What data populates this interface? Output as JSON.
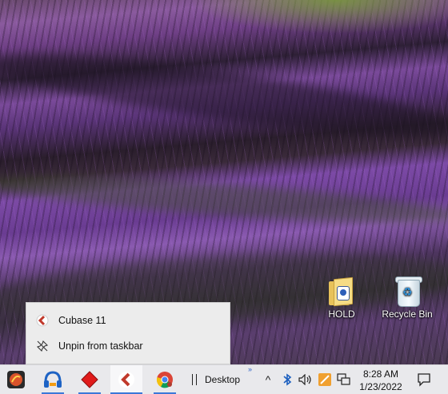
{
  "desktop": {
    "icons": [
      {
        "name": "folder-icon",
        "label": "HOLD"
      },
      {
        "name": "recycle-bin-icon",
        "label": "Recycle Bin"
      }
    ]
  },
  "jumplist": {
    "items": [
      {
        "label": "Cubase 11",
        "icon": "cubase-icon"
      },
      {
        "label": "Unpin from taskbar",
        "icon": "unpin-icon"
      }
    ]
  },
  "taskbar": {
    "apps": [
      {
        "name": "taskbar-app-1",
        "icon": "app-icon"
      },
      {
        "name": "taskbar-app-headphones",
        "icon": "headphones-icon"
      },
      {
        "name": "taskbar-app-red-diamond",
        "icon": "red-diamond-icon"
      },
      {
        "name": "taskbar-app-cubase",
        "icon": "cubase-icon"
      },
      {
        "name": "taskbar-app-chrome",
        "icon": "chrome-icon"
      }
    ],
    "desktop_toolbar_label": "Desktop",
    "toolbar_chevron": "»",
    "tray": {
      "overflow": "^",
      "icons": [
        "bluetooth-icon",
        "volume-icon",
        "app-tray-icon",
        "network-icon"
      ]
    },
    "clock": {
      "time": "8:28 AM",
      "date": "1/23/2022"
    },
    "notification_icon": "action-center-icon"
  },
  "colors": {
    "taskbar_bg": "#e9e9ec",
    "accent": "#3b78d8",
    "jumplist_bg": "#ececec"
  }
}
